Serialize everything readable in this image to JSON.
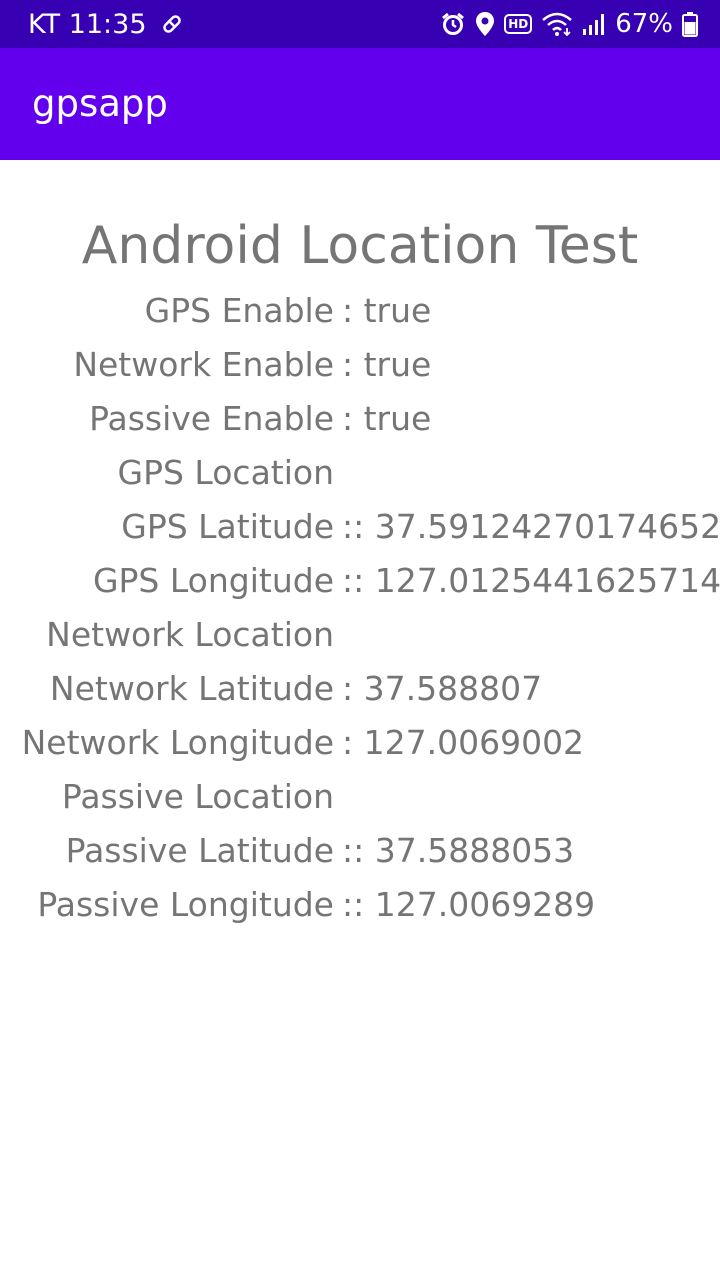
{
  "status_bar": {
    "carrier": "KT",
    "time": "11:35",
    "battery": "67%",
    "hd_badge": "HD",
    "icons": [
      "key-icon",
      "alarm-icon",
      "location-pin-icon",
      "hd-icon",
      "wifi-icon",
      "signal-icon",
      "battery-icon"
    ]
  },
  "app_bar": {
    "title": "gpsapp"
  },
  "main": {
    "title": "Android Location Test",
    "rows": [
      {
        "label": "GPS Enable",
        "value": ": true"
      },
      {
        "label": "Network Enable",
        "value": ": true"
      },
      {
        "label": "Passive Enable",
        "value": ": true"
      },
      {
        "label": "GPS Location",
        "value": ""
      },
      {
        "label": "GPS Latitude",
        "value": ":: 37.59124270174652"
      },
      {
        "label": "GPS Longitude",
        "value": ":: 127.0125441625714"
      },
      {
        "label": "Network Location",
        "value": ""
      },
      {
        "label": "Network Latitude",
        "value": ": 37.588807"
      },
      {
        "label": "Network Longitude",
        "value": ": 127.0069002"
      },
      {
        "label": "Passive Location",
        "value": ""
      },
      {
        "label": "Passive Latitude",
        "value": ":: 37.5888053"
      },
      {
        "label": "Passive Longitude",
        "value": ":: 127.0069289"
      }
    ]
  },
  "colors": {
    "status_bar": "#3700b3",
    "app_bar": "#6200ee",
    "text": "#757575"
  }
}
